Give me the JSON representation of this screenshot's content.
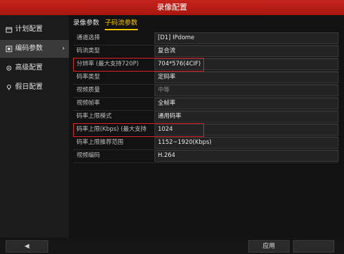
{
  "window": {
    "title": "录像配置"
  },
  "sidebar": {
    "items": [
      {
        "label": "计划配置",
        "icon": "calendar-icon"
      },
      {
        "label": "编码参数",
        "icon": "encode-icon",
        "active": true
      },
      {
        "label": "高级配置",
        "icon": "settings-icon"
      },
      {
        "label": "假日配置",
        "icon": "holiday-icon"
      }
    ]
  },
  "tabs": [
    {
      "label": "录像参数",
      "active": false
    },
    {
      "label": "子码流参数",
      "active": true
    }
  ],
  "rows": [
    {
      "label": "通道选择",
      "value": "[D1] IPdome"
    },
    {
      "label": "码流类型",
      "value": "复合流"
    },
    {
      "label": "分辨率 (最大支持720P)",
      "value": "704*576(4CIF)"
    },
    {
      "label": "码率类型",
      "value": "定码率"
    },
    {
      "label": "视频质量",
      "value": "中等",
      "dim": true
    },
    {
      "label": "视频帧率",
      "value": "全帧率"
    },
    {
      "label": "码率上限模式",
      "value": "通用码率"
    },
    {
      "label": "码率上限(Kbps) (最大支持",
      "value": "1024"
    },
    {
      "label": "码率上限推荐范围",
      "value": "1152~1920(Kbps)"
    },
    {
      "label": "视频编码",
      "value": "H.264"
    }
  ],
  "buttons": {
    "apply": "应用"
  },
  "colors": {
    "titlebar": "#b51d16",
    "active_tab": "#f2c200",
    "highlight_box": "#dd2222"
  }
}
